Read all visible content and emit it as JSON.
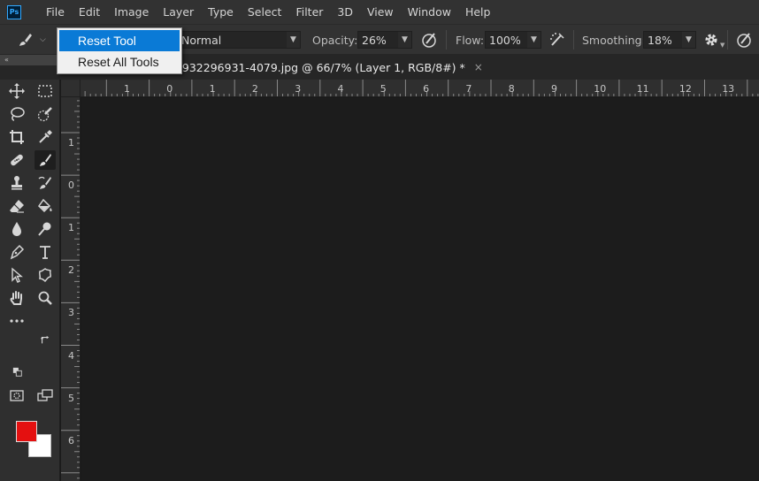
{
  "app": {
    "logo_text": "Ps"
  },
  "menubar": {
    "items": [
      "File",
      "Edit",
      "Image",
      "Layer",
      "Type",
      "Select",
      "Filter",
      "3D",
      "View",
      "Window",
      "Help"
    ]
  },
  "options": {
    "mode_value": "Normal",
    "opacity_label": "Opacity:",
    "opacity_value": "26%",
    "flow_label": "Flow:",
    "flow_value": "100%",
    "smoothing_label": "Smoothing:",
    "smoothing_value": "18%"
  },
  "context_menu": {
    "items": [
      "Reset Tool",
      "Reset All Tools"
    ],
    "highlighted": "Reset Tool"
  },
  "document_tab": {
    "title": "60932296931-4079.jpg @ 66/7% (Layer 1, RGB/8#) *",
    "close_glyph": "×"
  },
  "collapse_glyph": "«",
  "ruler_top": {
    "labels": [
      "1",
      "0",
      "1",
      "2",
      "3",
      "4",
      "5",
      "6",
      "7",
      "8",
      "9",
      "10",
      "11",
      "12",
      "13"
    ]
  },
  "ruler_left": {
    "labels": [
      "1",
      "0",
      "1",
      "2",
      "3",
      "4",
      "5",
      "6"
    ]
  },
  "colors": {
    "foreground": "#e41010",
    "background": "#ffffff",
    "accent": "#0a7ad6"
  },
  "tools": [
    "move-icon",
    "marquee-icon",
    "lasso-icon",
    "quick-select-icon",
    "crop-icon",
    "eyedropper-icon",
    "healing-brush-icon",
    "brush-icon",
    "clone-stamp-icon",
    "history-brush-icon",
    "eraser-icon",
    "paint-bucket-icon",
    "blur-icon",
    "dodge-icon",
    "pen-icon",
    "type-icon",
    "path-select-icon",
    "custom-shape-icon",
    "hand-icon",
    "zoom-icon",
    "more-tools-icon",
    "swap-colors-icon",
    "default-colors-icon",
    "quick-mask-icon",
    "screen-mode-icon"
  ]
}
